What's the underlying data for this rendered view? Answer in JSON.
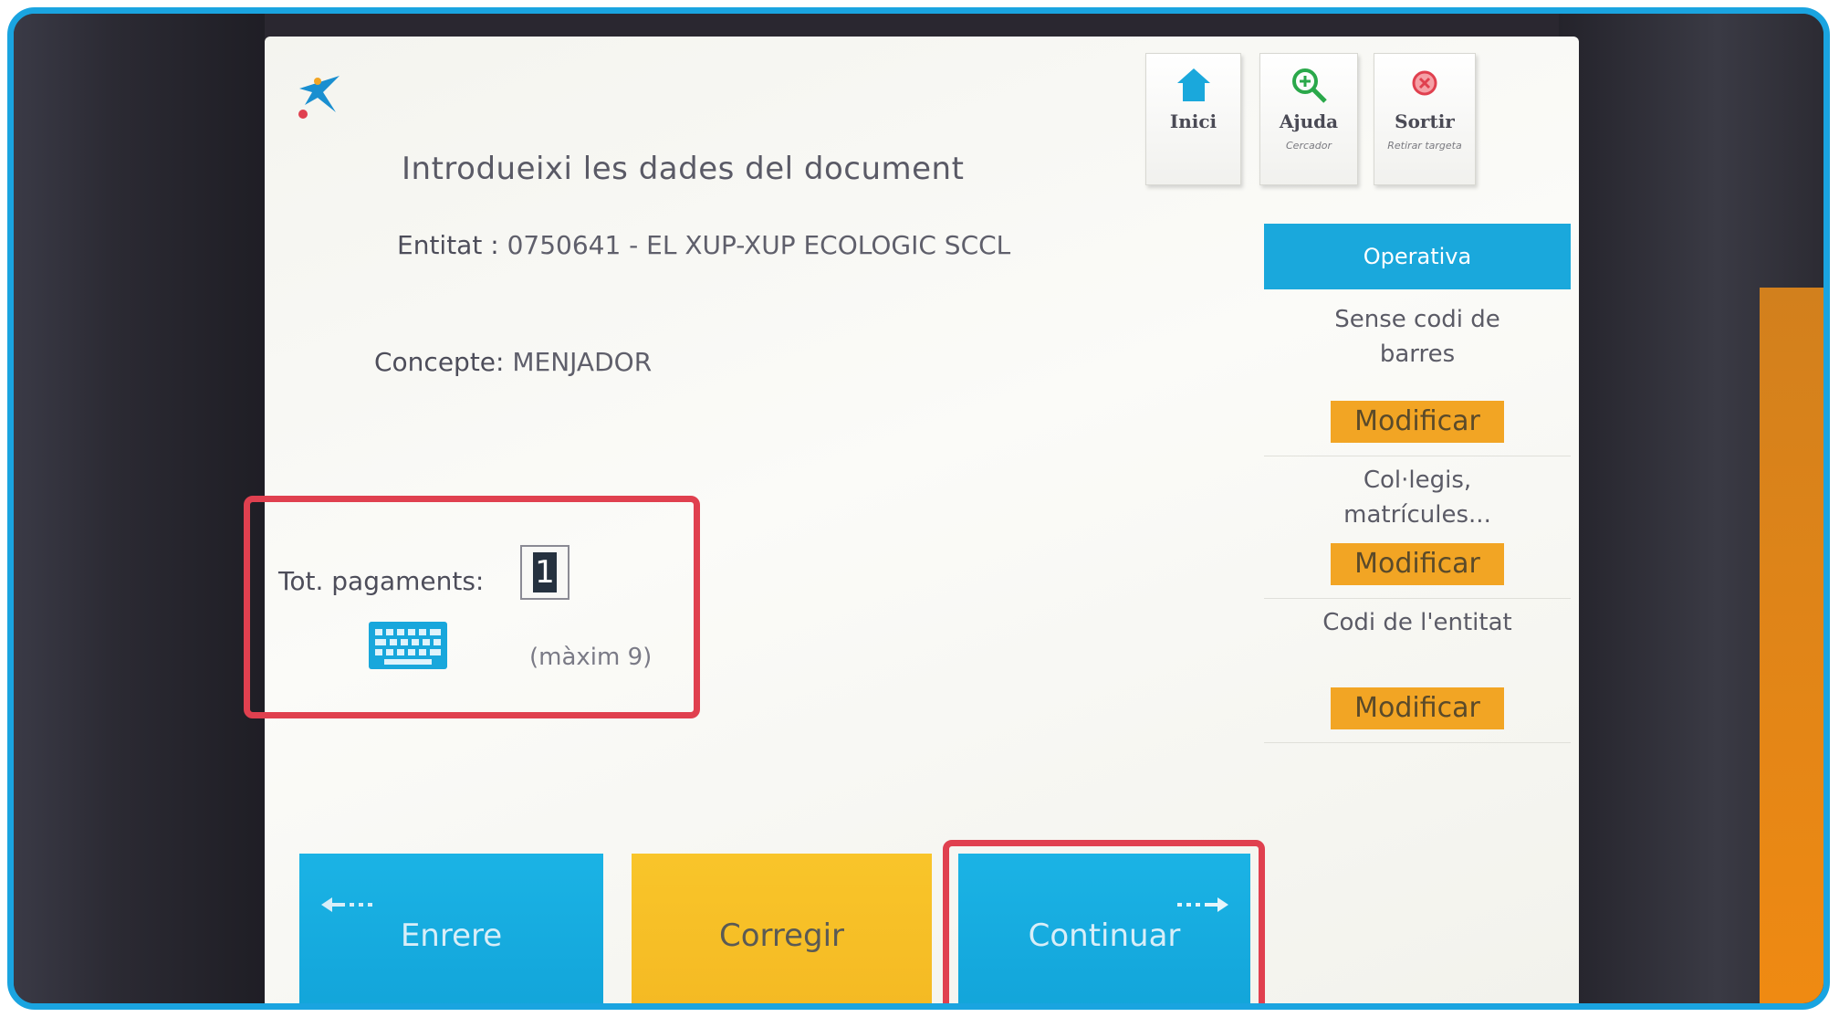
{
  "header": {
    "title": "Introdueixi les dades del document",
    "buttons": [
      {
        "label": "Inici",
        "sub": "",
        "icon": "home-icon"
      },
      {
        "label": "Ajuda",
        "sub": "Cercador",
        "icon": "zoom-in-icon"
      },
      {
        "label": "Sortir",
        "sub": "Retirar targeta",
        "icon": "exit-icon"
      }
    ]
  },
  "form": {
    "entitat_label": "Entitat :",
    "entitat_value": "0750641 - EL XUP-XUP ECOLOGIC SCCL",
    "concepte_label": "Concepte:",
    "concepte_value": "MENJADOR",
    "payments_label": "Tot. pagaments:",
    "payments_value": "1",
    "payments_hint": "(màxim 9)"
  },
  "side_panel": {
    "header": "Operativa",
    "options": [
      {
        "label_line1": "Sense codi de",
        "label_line2": "barres",
        "button": "Modificar"
      },
      {
        "label_line1": "Col·legis,",
        "label_line2": "matrícules...",
        "button": "Modificar"
      },
      {
        "label_line1": "Codi de l'entitat",
        "label_line2": "",
        "button": "Modificar"
      }
    ]
  },
  "footer": {
    "back": "Enrere",
    "correct": "Corregir",
    "continue": "Continuar"
  },
  "colors": {
    "accent_blue": "#1aa8dc",
    "modify_orange": "#f2a524",
    "highlight_red": "#e0404f",
    "frame_blue": "#1aa4e0"
  }
}
